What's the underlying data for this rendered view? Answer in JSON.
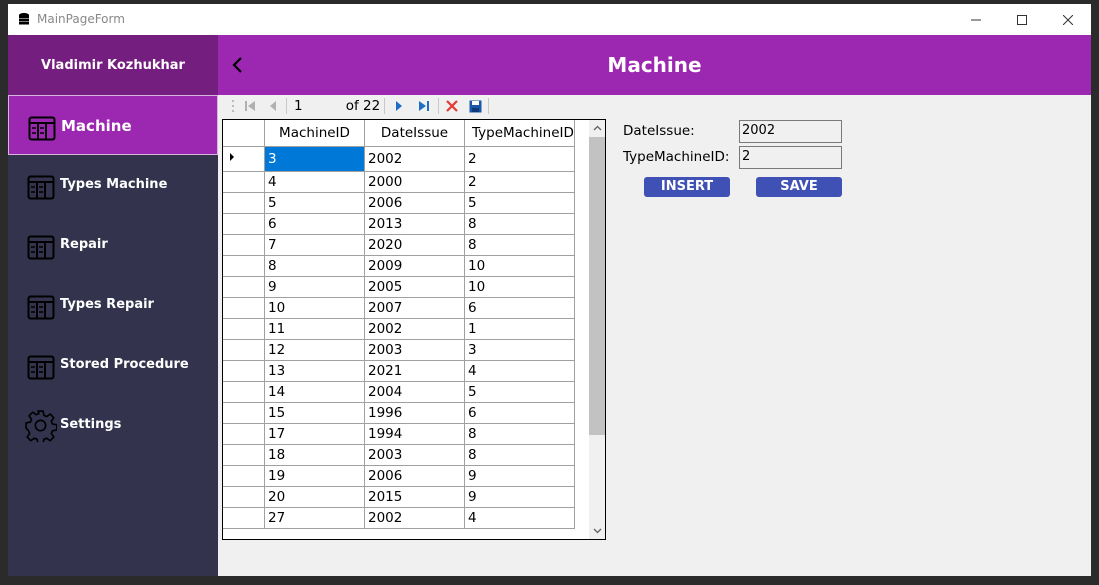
{
  "window": {
    "title": "MainPageForm"
  },
  "sidebar": {
    "user": "Vladimir Kozhukhar",
    "items": [
      {
        "label": "Machine",
        "icon": "table-icon",
        "active": true
      },
      {
        "label": "Types Machine",
        "icon": "table-icon"
      },
      {
        "label": "Repair",
        "icon": "table-icon"
      },
      {
        "label": "Types Repair",
        "icon": "table-icon"
      },
      {
        "label": "Stored Procedure",
        "icon": "table-icon"
      },
      {
        "label": "Settings",
        "icon": "gear-icon"
      }
    ]
  },
  "header": {
    "title": "Machine"
  },
  "navigator": {
    "position": "1",
    "count": "of 22"
  },
  "grid": {
    "columns": [
      "MachineID",
      "DateIssue",
      "TypeMachineID"
    ],
    "rows": [
      [
        "3",
        "2002",
        "2"
      ],
      [
        "4",
        "2000",
        "2"
      ],
      [
        "5",
        "2006",
        "5"
      ],
      [
        "6",
        "2013",
        "8"
      ],
      [
        "7",
        "2020",
        "8"
      ],
      [
        "8",
        "2009",
        "10"
      ],
      [
        "9",
        "2005",
        "10"
      ],
      [
        "10",
        "2007",
        "6"
      ],
      [
        "11",
        "2002",
        "1"
      ],
      [
        "12",
        "2003",
        "3"
      ],
      [
        "13",
        "2021",
        "4"
      ],
      [
        "14",
        "2004",
        "5"
      ],
      [
        "15",
        "1996",
        "6"
      ],
      [
        "17",
        "1994",
        "8"
      ],
      [
        "18",
        "2003",
        "8"
      ],
      [
        "19",
        "2006",
        "9"
      ],
      [
        "20",
        "2015",
        "9"
      ],
      [
        "27",
        "2002",
        "4"
      ]
    ]
  },
  "form": {
    "date_issue_label": "DateIssue:",
    "date_issue_value": "2002",
    "type_label": "TypeMachineID:",
    "type_value": "2",
    "insert_label": "INSERT",
    "save_label": "SAVE"
  },
  "colors": {
    "accent": "#9c27b0",
    "sidebar": "#33334d",
    "user_bg": "#741e80",
    "button": "#3f51b5",
    "selection": "#0078d7"
  }
}
